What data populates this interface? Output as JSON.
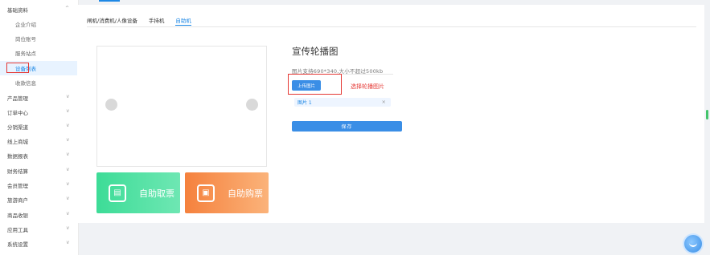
{
  "sidebar": {
    "items": [
      {
        "label": "基础资料",
        "chevron": "^"
      },
      {
        "label": "企业介绍"
      },
      {
        "label": "岗位账号"
      },
      {
        "label": "服务站点"
      },
      {
        "label": "设备列表"
      },
      {
        "label": "收款信息"
      },
      {
        "label": "产品管理",
        "chevron": "v"
      },
      {
        "label": "订单中心",
        "chevron": "v"
      },
      {
        "label": "分销渠道",
        "chevron": "v"
      },
      {
        "label": "线上商城",
        "chevron": "v"
      },
      {
        "label": "数据报表",
        "chevron": "v"
      },
      {
        "label": "财务结算",
        "chevron": "v"
      },
      {
        "label": "会员管理",
        "chevron": "v"
      },
      {
        "label": "旅游商户",
        "chevron": "v"
      },
      {
        "label": "商品收银",
        "chevron": "v"
      },
      {
        "label": "应用工具",
        "chevron": "v"
      },
      {
        "label": "系统设置",
        "chevron": "v"
      }
    ]
  },
  "tabs": [
    "闸机/消费机/人像设备",
    "手持机",
    "自助机"
  ],
  "preview": {
    "card_take": "自助取票",
    "card_buy": "自助购票"
  },
  "form": {
    "title": "宣传轮播图",
    "hint": "图片支持690*340,大小不超过500kb",
    "upload_label": "上传图片",
    "upload_tip": "选择轮播图片",
    "file_name": "图片 1",
    "file_remove": "×",
    "save_label": "保存"
  },
  "colors": {
    "accent": "#1e88e5",
    "highlight": "#e53935",
    "card_take": "#3ddc97",
    "card_buy": "#f5813d"
  }
}
